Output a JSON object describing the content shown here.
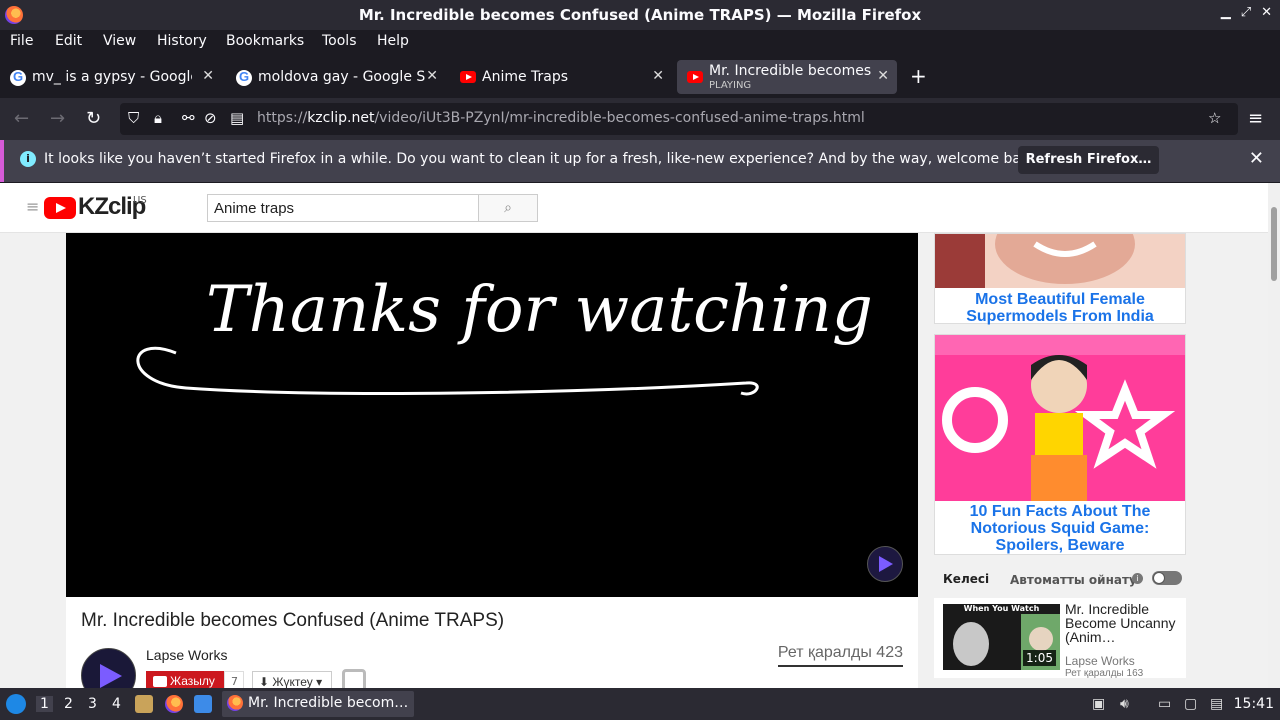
{
  "window": {
    "title": "Mr. Incredible becomes Confused (Anime TRAPS) — Mozilla Firefox"
  },
  "menu": [
    "File",
    "Edit",
    "View",
    "History",
    "Bookmarks",
    "Tools",
    "Help"
  ],
  "tabs": [
    {
      "label": "mv_ is a gypsy - Google S",
      "icon": "google-icon"
    },
    {
      "label": "moldova gay - Google Se",
      "icon": "google-icon"
    },
    {
      "label": "Anime Traps",
      "icon": "youtube-icon"
    },
    {
      "label": "Mr. Incredible becomes C",
      "sub": "PLAYING",
      "icon": "youtube-icon",
      "active": true
    }
  ],
  "url": {
    "prefix": "https://",
    "domain": "kzclip.net",
    "path": "/video/iUt3B-PZynI/mr-incredible-becomes-confused-anime-traps.html"
  },
  "notification": {
    "message": "It looks like you haven’t started Firefox in a while. Do you want to clean it up for a fresh, like-new experience? And by the way, welcome back!",
    "button": "Refresh Firefox…"
  },
  "site": {
    "logo": "KZclip",
    "country": "US",
    "search_value": "Anime traps"
  },
  "video": {
    "overlay_text": "Thanks for watching",
    "title": "Mr. Incredible becomes Confused (Anime TRAPS)",
    "channel": "Lapse Works",
    "subscribe_label": "Жазылу",
    "subscribe_count": "7",
    "download_label": "Жүктеу",
    "views": "Рет қаралды 423"
  },
  "sidebar": {
    "ad1_caption": "Most Beautiful Female Supermodels From India",
    "ad2_caption": "10 Fun Facts About The Notorious Squid Game: Spoilers, Beware",
    "next_label": "Келесі",
    "autoplay_label": "Автоматты ойнату",
    "related": {
      "thumb_caption": "When You Watch",
      "duration": "1:05",
      "title": "Mr. Incredible Become Uncanny (Anim…",
      "channel": "Lapse Works",
      "views": "Рет қаралды 163"
    }
  },
  "taskbar": {
    "workspaces": [
      "1",
      "2",
      "3",
      "4"
    ],
    "task_title": "Mr. Incredible becom…",
    "clock": "15:41"
  },
  "colors": {
    "firefox_dark": "#1c1b22",
    "toolbar": "#2b2a33",
    "accent_red": "#ff0000",
    "ad_link": "#1a73e8"
  }
}
